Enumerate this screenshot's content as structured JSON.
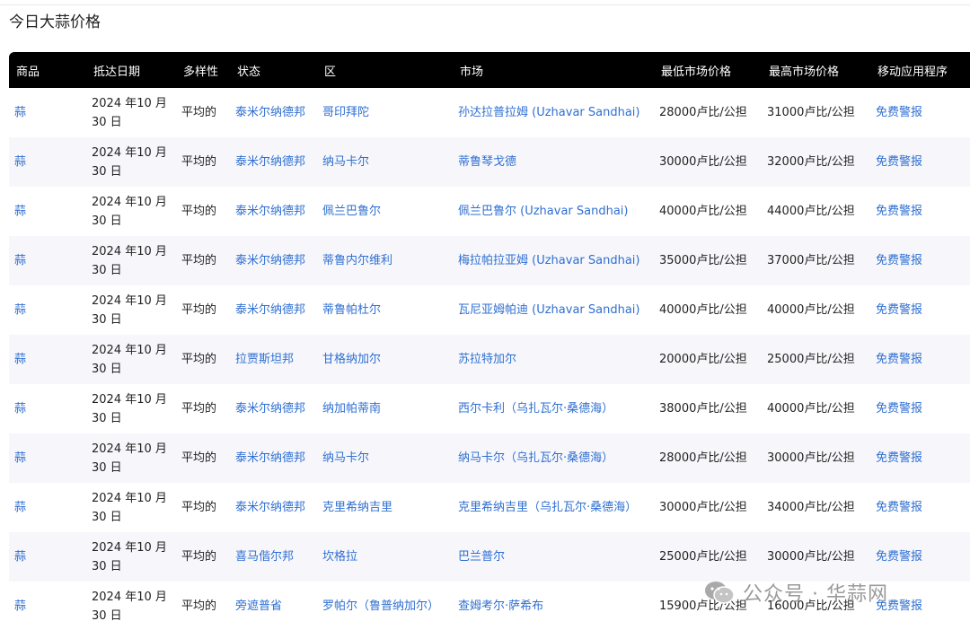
{
  "title": "今日大蒜价格",
  "table": {
    "headers": [
      "商品",
      "抵达日期",
      "多样性",
      "状态",
      "区",
      "市场",
      "最低市场价格",
      "最高市场价格",
      "移动应用程序"
    ],
    "rows": [
      {
        "commodity": "蒜",
        "date": "2024 年10 月30 日",
        "variety": "平均的",
        "state": "泰米尔纳德邦",
        "district": "哥印拜陀",
        "market": "孙达拉普拉姆 (Uzhavar Sandhai)",
        "min_price": "28000卢比/公担",
        "max_price": "31000卢比/公担",
        "app": "免费警报"
      },
      {
        "commodity": "蒜",
        "date": "2024 年10 月30 日",
        "variety": "平均的",
        "state": "泰米尔纳德邦",
        "district": "纳马卡尔",
        "market": "蒂鲁琴戈德",
        "min_price": "30000卢比/公担",
        "max_price": "32000卢比/公担",
        "app": "免费警报"
      },
      {
        "commodity": "蒜",
        "date": "2024 年10 月30 日",
        "variety": "平均的",
        "state": "泰米尔纳德邦",
        "district": "佩兰巴鲁尔",
        "market": "佩兰巴鲁尔 (Uzhavar Sandhai)",
        "min_price": "40000卢比/公担",
        "max_price": "44000卢比/公担",
        "app": "免费警报"
      },
      {
        "commodity": "蒜",
        "date": "2024 年10 月30 日",
        "variety": "平均的",
        "state": "泰米尔纳德邦",
        "district": "蒂鲁内尔维利",
        "market": "梅拉帕拉亚姆 (Uzhavar Sandhai)",
        "min_price": "35000卢比/公担",
        "max_price": "37000卢比/公担",
        "app": "免费警报"
      },
      {
        "commodity": "蒜",
        "date": "2024 年10 月30 日",
        "variety": "平均的",
        "state": "泰米尔纳德邦",
        "district": "蒂鲁帕杜尔",
        "market": "瓦尼亚姆帕迪 (Uzhavar Sandhai)",
        "min_price": "40000卢比/公担",
        "max_price": "40000卢比/公担",
        "app": "免费警报"
      },
      {
        "commodity": "蒜",
        "date": "2024 年10 月30 日",
        "variety": "平均的",
        "state": "拉贾斯坦邦",
        "district": "甘格纳加尔",
        "market": "苏拉特加尔",
        "min_price": "20000卢比/公担",
        "max_price": "25000卢比/公担",
        "app": "免费警报"
      },
      {
        "commodity": "蒜",
        "date": "2024 年10 月30 日",
        "variety": "平均的",
        "state": "泰米尔纳德邦",
        "district": "纳加帕蒂南",
        "market": "西尔卡利（乌扎瓦尔·桑德海）",
        "min_price": "38000卢比/公担",
        "max_price": "40000卢比/公担",
        "app": "免费警报"
      },
      {
        "commodity": "蒜",
        "date": "2024 年10 月30 日",
        "variety": "平均的",
        "state": "泰米尔纳德邦",
        "district": "纳马卡尔",
        "market": "纳马卡尔（乌扎瓦尔·桑德海）",
        "min_price": "28000卢比/公担",
        "max_price": "30000卢比/公担",
        "app": "免费警报"
      },
      {
        "commodity": "蒜",
        "date": "2024 年10 月30 日",
        "variety": "平均的",
        "state": "泰米尔纳德邦",
        "district": "克里希纳吉里",
        "market": "克里希纳吉里（乌扎瓦尔·桑德海）",
        "min_price": "30000卢比/公担",
        "max_price": "34000卢比/公担",
        "app": "免费警报"
      },
      {
        "commodity": "蒜",
        "date": "2024 年10 月30 日",
        "variety": "平均的",
        "state": "喜马偕尔邦",
        "district": "坎格拉",
        "market": "巴兰普尔",
        "min_price": "25000卢比/公担",
        "max_price": "30000卢比/公担",
        "app": "免费警报"
      },
      {
        "commodity": "蒜",
        "date": "2024 年10 月30 日",
        "variety": "平均的",
        "state": "旁遮普省",
        "district": "罗帕尔（鲁普纳加尔）",
        "market": "查姆考尔·萨希布",
        "min_price": "15900卢比/公担",
        "max_price": "16000卢比/公担",
        "app": "免费警报"
      }
    ]
  },
  "watermark": {
    "text": "公众号 · 华蒜网",
    "icon": "wechat-logo-icon"
  }
}
